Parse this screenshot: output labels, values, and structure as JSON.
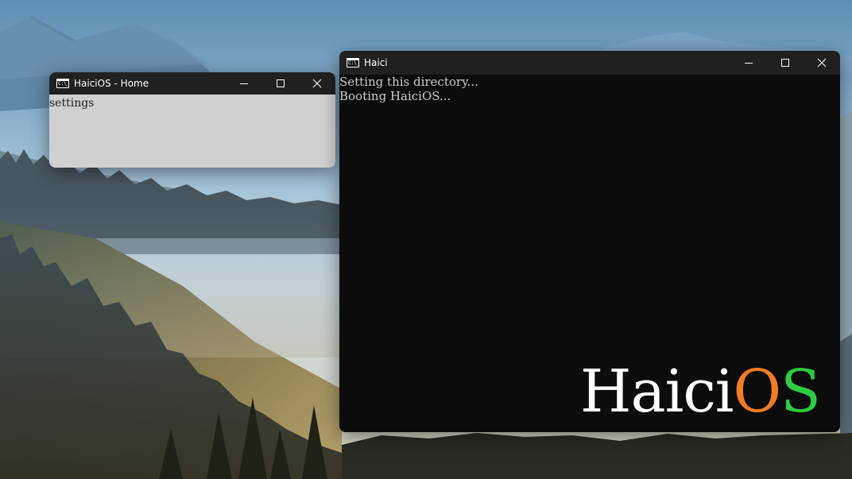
{
  "home_window": {
    "title": "HaiciOS - Home",
    "content_text": "settings"
  },
  "terminal_window": {
    "title": "Haici",
    "lines": [
      "Setting this directory...",
      "Booting HaiciOS..."
    ]
  },
  "logo": {
    "part1": "Haici",
    "part2": "O",
    "part3": "S",
    "colors": {
      "part1": "#ffffff",
      "part2": "#f07c24",
      "part3": "#2ecc40"
    }
  },
  "app_icon_text": "C:\\_"
}
